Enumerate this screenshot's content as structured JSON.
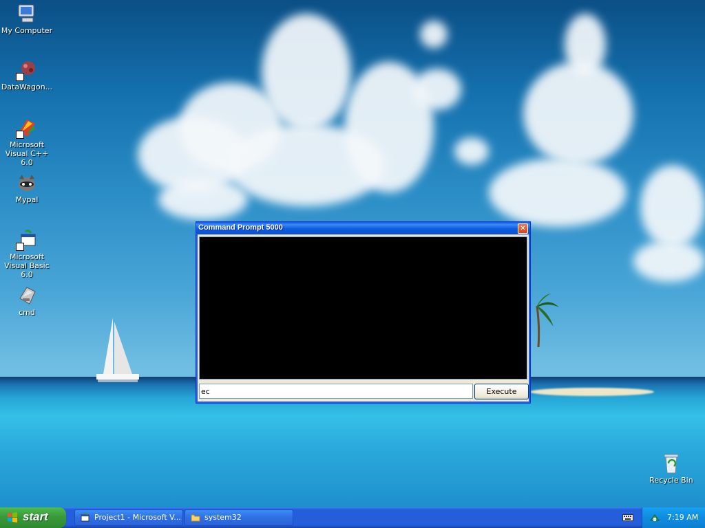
{
  "desktop": {
    "icons": [
      {
        "label": "My Computer",
        "icon": "my-computer-icon"
      },
      {
        "label": "DataWagon...",
        "icon": "datawagon-icon"
      },
      {
        "label": "Microsoft Visual C++ 6.0",
        "icon": "visual-cpp-icon"
      },
      {
        "label": "Mypal",
        "icon": "mypal-icon"
      },
      {
        "label": "Microsoft Visual Basic 6.0",
        "icon": "visual-basic-icon"
      },
      {
        "label": "cmd",
        "icon": "cmd-icon"
      }
    ],
    "recycle_bin": {
      "label": "Recycle Bin",
      "icon": "recycle-bin-icon"
    }
  },
  "window": {
    "title": "Command Prompt 5000",
    "input_value": "ec",
    "execute_label": "Execute"
  },
  "taskbar": {
    "start_label": "start",
    "tasks": [
      {
        "label": "Project1 - Microsoft V...",
        "icon": "vb-project-icon"
      },
      {
        "label": "system32",
        "icon": "folder-icon"
      }
    ],
    "clock": "7:19 AM"
  },
  "colors": {
    "taskbar_blue": "#245edb",
    "start_green": "#3a9a3a",
    "tray_blue": "#0f8ce0",
    "console_black": "#000000"
  }
}
